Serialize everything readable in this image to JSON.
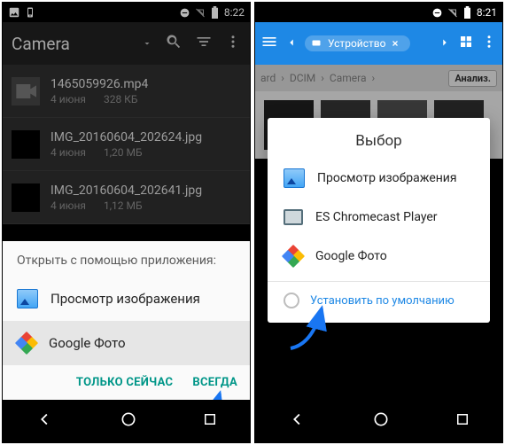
{
  "left": {
    "status": {
      "time": "8:22"
    },
    "toolbar": {
      "title": "Camera"
    },
    "files": [
      {
        "name": "1465059926.mp4",
        "date": "4 июня",
        "size": "328 КБ"
      },
      {
        "name": "IMG_20160604_202624.jpg",
        "date": "4 июня",
        "size": "1,20 МБ"
      },
      {
        "name": "IMG_20160604_202641.jpg",
        "date": "4 июня",
        "size": "1,12 МБ"
      }
    ],
    "sheet": {
      "header": "Открыть с помощью приложения:",
      "options": [
        {
          "label": "Просмотр изображения"
        },
        {
          "label": "Google Фото"
        }
      ],
      "just_once": "ТОЛЬКО СЕЙЧАС",
      "always": "ВСЕГДА"
    }
  },
  "right": {
    "status": {
      "time": "8:21"
    },
    "chip": "Устройство",
    "crumbs": {
      "a": "ard",
      "b": "DCIM",
      "c": "Camera",
      "analyze": "Анализ."
    },
    "dialog": {
      "title": "Выбор",
      "options": [
        {
          "label": "Просмотр изображения"
        },
        {
          "label": "ES Chromecast Player"
        },
        {
          "label": "Google Фото"
        }
      ],
      "default": "Установить по умолчанию"
    }
  }
}
